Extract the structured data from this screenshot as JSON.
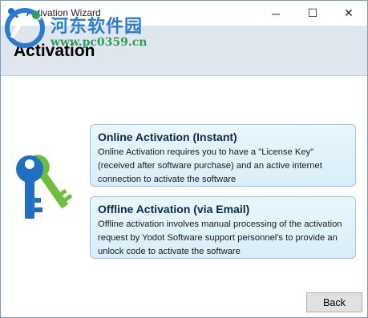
{
  "window": {
    "title": "Activation Wizard",
    "controls": {
      "minimize": "─",
      "maximize": "☐",
      "close": "✕"
    }
  },
  "watermark": {
    "line1": "河东软件园",
    "line2": "www.pc0359.cn"
  },
  "header": {
    "title": "Activation"
  },
  "options": [
    {
      "title": "Online Activation (Instant)",
      "description": "Online Activation requires you to have a \"License Key\" (received after software purchase) and an active internet connection to activate the software"
    },
    {
      "title": "Offline Activation (via Email)",
      "description": "Offline activation involves manual processing of the activation request by Yodot Software support personnel's to provide an unlock code to activate the software"
    }
  ],
  "footer": {
    "back_label": "Back"
  },
  "colors": {
    "header_bg": "#dfe6ee",
    "option_bg": "#e3f3fb",
    "option_border": "#9cc7de",
    "key_blue": "#1f6fc4",
    "key_green": "#6cbf3a"
  },
  "icons": {
    "app": "key-icon",
    "graphic": "keys-icon"
  }
}
